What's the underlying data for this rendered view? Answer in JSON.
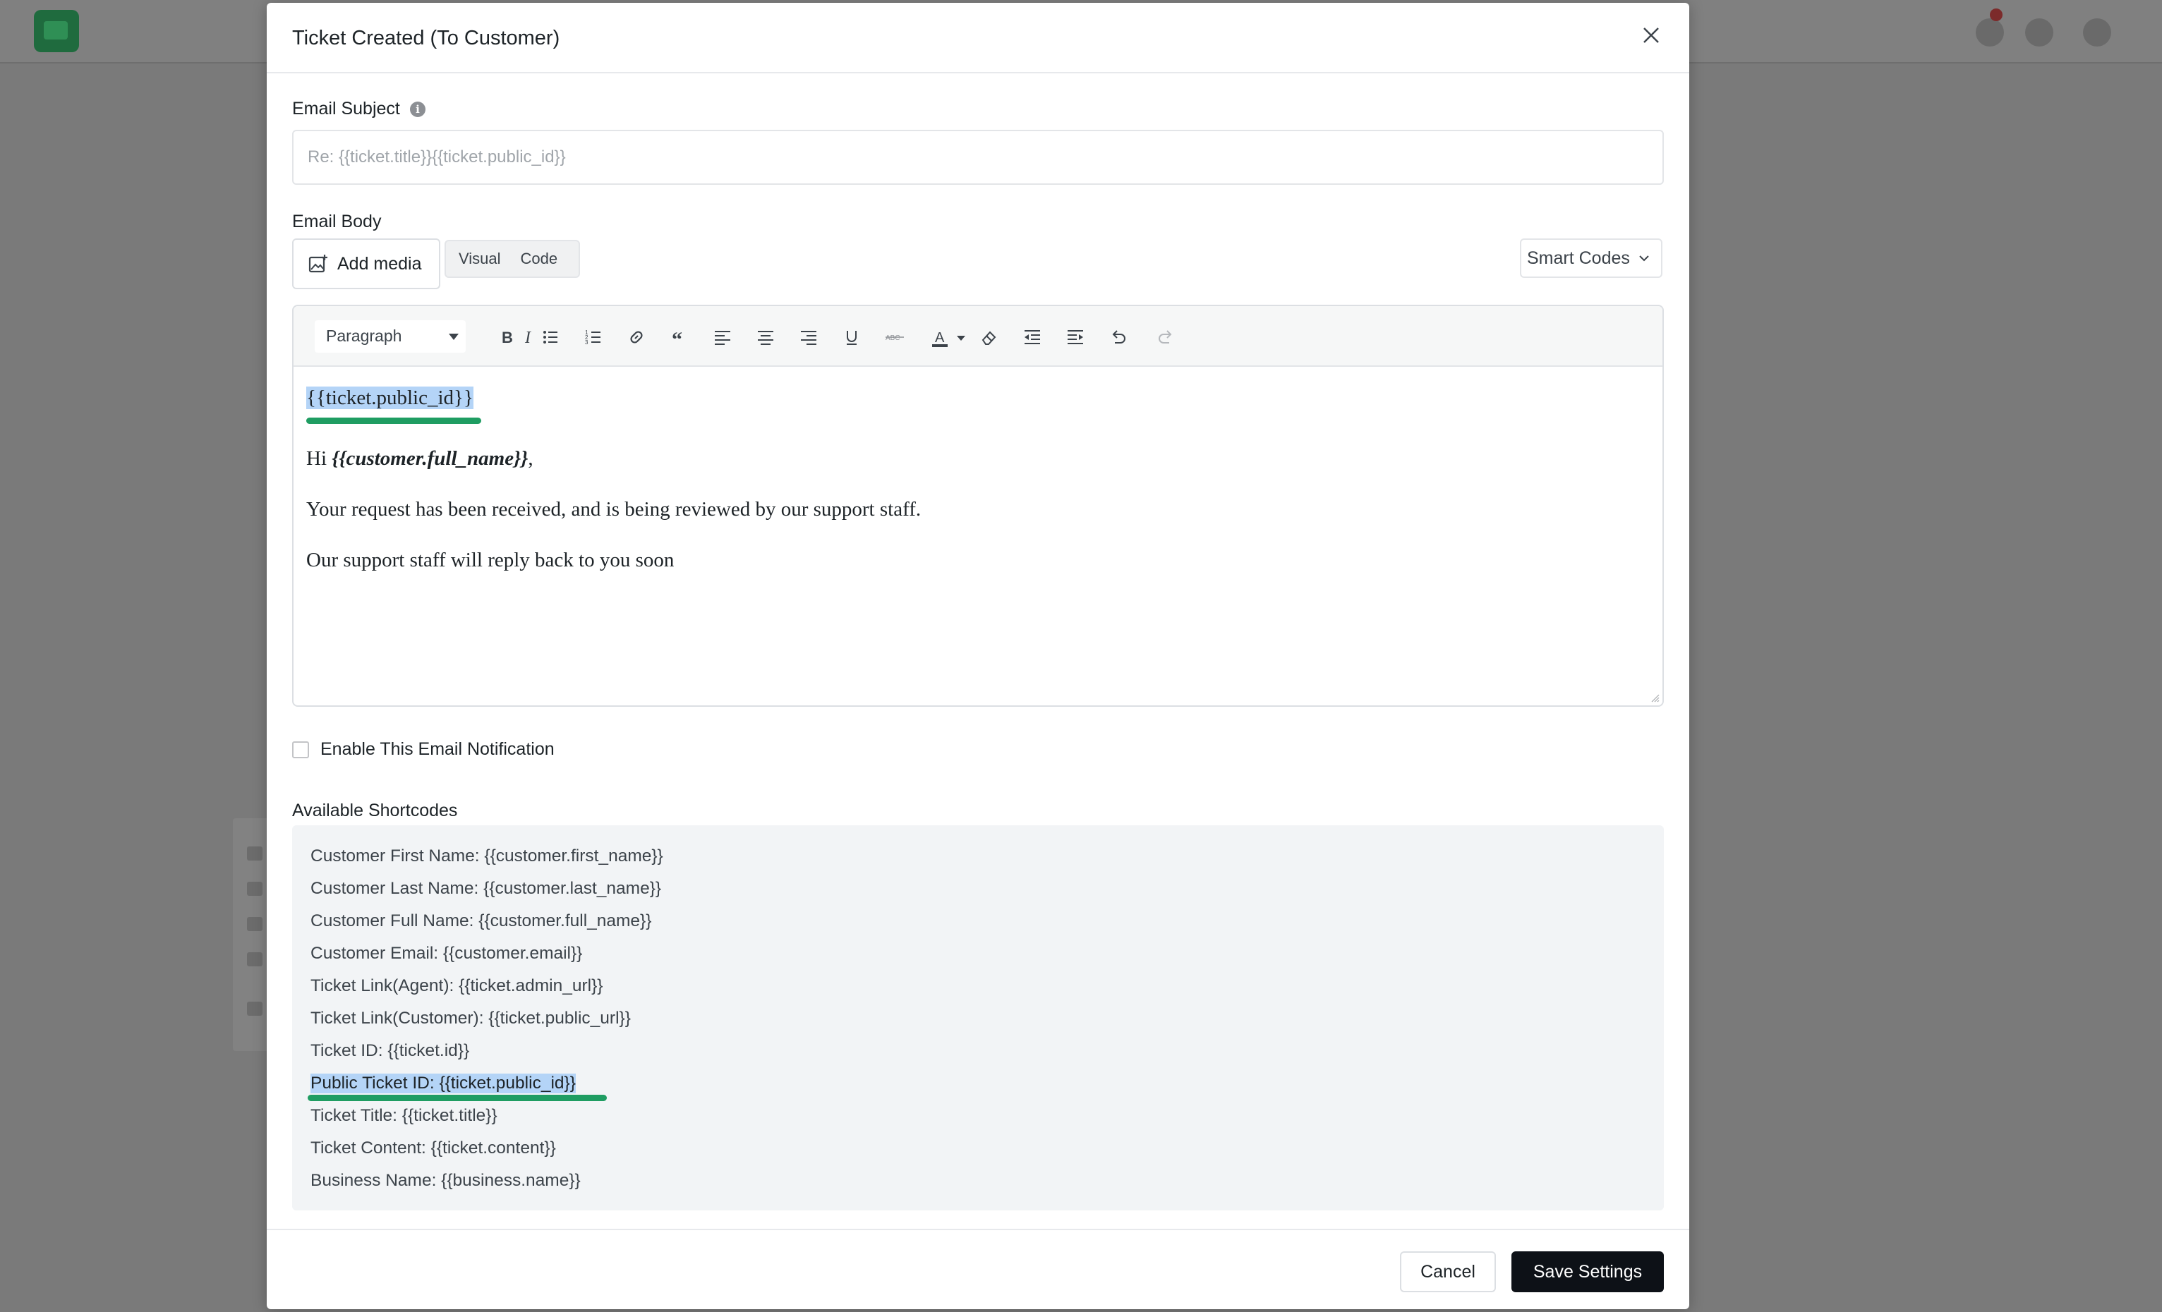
{
  "modal": {
    "title": "Ticket Created (To Customer)"
  },
  "subject": {
    "label": "Email Subject",
    "placeholder": "Re: {{ticket.title}}{{ticket.public_id}}"
  },
  "body": {
    "label": "Email Body",
    "add_media": "Add media",
    "tabs": [
      "Visual",
      "Code"
    ],
    "smart_codes": "Smart Codes",
    "format": "Paragraph",
    "content": {
      "line1": "{{ticket.public_id}}",
      "greeting_prefix": "Hi ",
      "greeting_name": "{{customer.full_name}}",
      "greeting_suffix": ",",
      "line3": "Your request has been received, and is being reviewed by our support staff.",
      "line4": "Our support staff will reply back to you soon"
    }
  },
  "enable_label": "Enable This Email Notification",
  "shortcodes": {
    "title": "Available Shortcodes",
    "items": [
      "Customer First Name: {{customer.first_name}}",
      "Customer Last Name: {{customer.last_name}}",
      "Customer Full Name: {{customer.full_name}}",
      "Customer Email: {{customer.email}}",
      "Ticket Link(Agent): {{ticket.admin_url}}",
      "Ticket Link(Customer): {{ticket.public_url}}",
      "Ticket ID: {{ticket.id}}",
      "Public Ticket ID: {{ticket.public_id}}",
      "Ticket Title: {{ticket.title}}",
      "Ticket Content: {{ticket.content}}",
      "Business Name: {{business.name}}"
    ]
  },
  "footer": {
    "cancel": "Cancel",
    "save": "Save Settings"
  },
  "colors": {
    "accent_green": "#1f9d62",
    "highlight": "#b4d4f7",
    "primary_button": "#0d1117"
  }
}
